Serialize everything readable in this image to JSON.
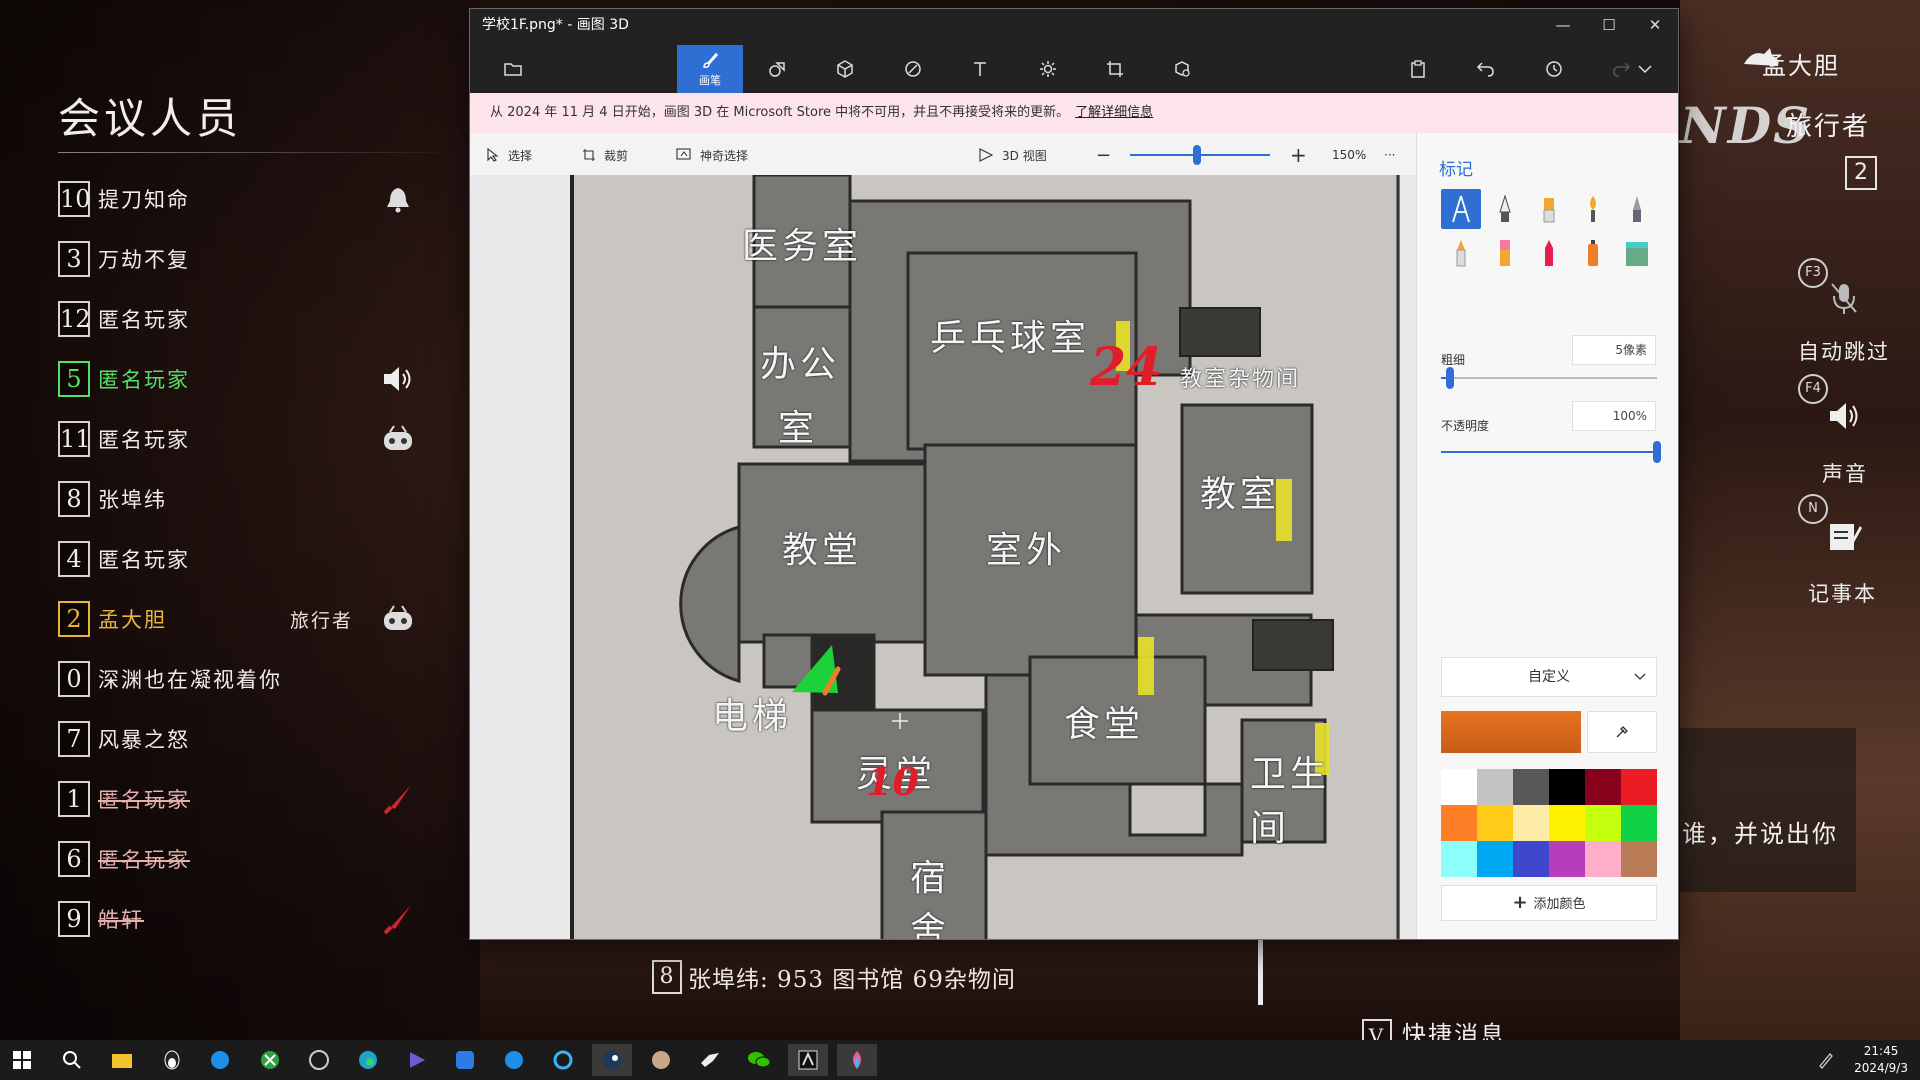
{
  "meeting": {
    "title": "会议人员",
    "players": [
      {
        "num": "10",
        "name": "提刀知命",
        "role": "",
        "style": "normal",
        "icon": "bell-icon"
      },
      {
        "num": "3",
        "name": "万劫不复",
        "role": "",
        "style": "normal",
        "icon": ""
      },
      {
        "num": "12",
        "name": "匿名玩家",
        "role": "",
        "style": "normal",
        "icon": ""
      },
      {
        "num": "5",
        "name": "匿名玩家",
        "role": "",
        "style": "green",
        "icon": "speaker-icon"
      },
      {
        "num": "11",
        "name": "匿名玩家",
        "role": "",
        "style": "normal",
        "icon": "robot-icon"
      },
      {
        "num": "8",
        "name": "张埠纬",
        "role": "",
        "style": "normal",
        "icon": ""
      },
      {
        "num": "4",
        "name": "匿名玩家",
        "role": "",
        "style": "normal",
        "icon": ""
      },
      {
        "num": "2",
        "name": "孟大胆",
        "role": "旅行者",
        "style": "gold",
        "icon": "robot-icon"
      },
      {
        "num": "0",
        "name": "深渊也在凝视着你",
        "role": "",
        "style": "normal",
        "icon": ""
      },
      {
        "num": "7",
        "name": "风暴之怒",
        "role": "",
        "style": "normal",
        "icon": ""
      },
      {
        "num": "1",
        "name": "匿名玩家",
        "role": "",
        "style": "dead",
        "icon": "knife-icon"
      },
      {
        "num": "6",
        "name": "匿名玩家",
        "role": "",
        "style": "dead",
        "icon": ""
      },
      {
        "num": "9",
        "name": "皓轩",
        "role": "",
        "style": "dead",
        "icon": "knife-icon"
      }
    ]
  },
  "hud": {
    "self_name": "孟大胆",
    "role": "旅行者",
    "logo": "NDS",
    "self_num": "2",
    "key_f3": "F3",
    "auto_skip": "自动跳过",
    "key_f4": "F4",
    "sound": "声音",
    "key_n": "N",
    "notepad": "记事本"
  },
  "chat": {
    "num": "8",
    "text": "张埠纬: 953 图书馆 69杂物间",
    "quick_key": "V",
    "quick_label": "快捷消息",
    "popup": "谁，并说出你"
  },
  "paint": {
    "window_title": "学校1F.png* - 画图 3D",
    "win_minimize": "—",
    "win_maximize": "☐",
    "win_close": "✕",
    "tools": {
      "brushes": "画笔"
    },
    "notice": "从 2024 年 11 月 4 日开始，画图 3D 在 Microsoft Store 中将不可用，并且不再接受将来的更新。",
    "notice_link": "了解详细信息",
    "subbar": {
      "select": "选择",
      "crop": "裁剪",
      "magic": "神奇选择",
      "view3d": "3D 视图",
      "zoom": "150%",
      "more": "···"
    },
    "zoom_level": 0.42,
    "side": {
      "title": "标记",
      "thickness_label": "粗细",
      "thickness_value": "5像素",
      "thickness_level": 0.04,
      "opacity_label": "不透明度",
      "opacity_value": "100%",
      "opacity_level": 1.0,
      "color_mode": "自定义",
      "add_color": "添加颜色",
      "current_color": "#e8721f",
      "palette": [
        "#ffffff",
        "#c3c3c3",
        "#585858",
        "#000000",
        "#88001b",
        "#ec1c24",
        "#ff7f27",
        "#ffca18",
        "#fdeca6",
        "#fff200",
        "#c4ff0e",
        "#0ed145",
        "#8cfffb",
        "#00a8f3",
        "#3f48cc",
        "#b83dba",
        "#ffaec8",
        "#b97a56"
      ]
    },
    "map_labels": {
      "medical": "医务室",
      "office_1": "办公",
      "office_2": "室",
      "pingpong": "乒乓球室",
      "storage": "教室杂物间",
      "classroom": "教室",
      "church": "教堂",
      "outdoor": "室外",
      "elevator": "电梯",
      "spirit": "灵堂",
      "canteen": "食堂",
      "toilet_1": "卫生",
      "toilet_2": "间",
      "dorm_1": "宿",
      "dorm_2": "舍",
      "mark_24": "24",
      "mark_10": "10"
    }
  },
  "taskbar": {
    "time": "21:45",
    "date": "2024/9/3"
  }
}
